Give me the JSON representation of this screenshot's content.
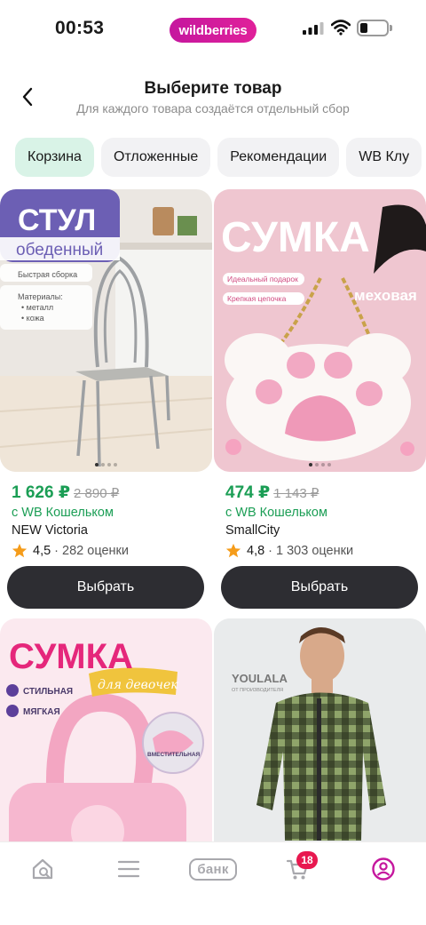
{
  "status": {
    "time": "00:53",
    "brand_pill": "wildberries"
  },
  "header": {
    "title": "Выберите товар",
    "subtitle": "Для каждого товара создаётся отдельный сбор"
  },
  "tabs": [
    {
      "label": "Корзина",
      "active": true
    },
    {
      "label": "Отложенные",
      "active": false
    },
    {
      "label": "Рекомендации",
      "active": false
    },
    {
      "label": "WB Клу",
      "active": false
    }
  ],
  "products": [
    {
      "price": "1 626 ₽",
      "old_price": "2 890 ₽",
      "wallet": "с WB Кошельком",
      "brand": "NEW Victoria",
      "rating": "4,5",
      "reviews": "· 282 оценки",
      "button": "Выбрать",
      "image_text": {
        "title": "СТУЛ",
        "subtitle": "обеденный",
        "note": "Быстрая сборка",
        "materials_label": "Материалы:",
        "material_1": "• металл",
        "material_2": "• кожа"
      }
    },
    {
      "price": "474 ₽",
      "old_price": "1 143 ₽",
      "wallet": "с WB Кошельком",
      "brand": "SmallCity",
      "rating": "4,8",
      "reviews": "· 1 303 оценки",
      "button": "Выбрать",
      "image_text": {
        "title": "СУМКА",
        "tag_1": "Идеальный подарок",
        "tag_2": "Крепкая цепочка",
        "side_label": "меховая"
      }
    },
    {
      "image_text": {
        "title": "СУМКА",
        "script": "для девочек",
        "feature_1": "СТИЛЬНАЯ",
        "feature_2": "МЯГКАЯ",
        "feature_3": "ВМЕСТИТЕЛЬНАЯ"
      }
    },
    {
      "image_text": {
        "logo": "YOULALA",
        "logo_sub": "ОТ ПРОИЗВОДИТЕЛЯ"
      }
    }
  ],
  "bottom_nav": {
    "items": [
      "home-search-icon",
      "catalog-menu-icon",
      "bank-button",
      "cart-icon",
      "profile-icon"
    ],
    "bank_label": "банк",
    "cart_count": "18",
    "accent_color": "#c5179e"
  }
}
